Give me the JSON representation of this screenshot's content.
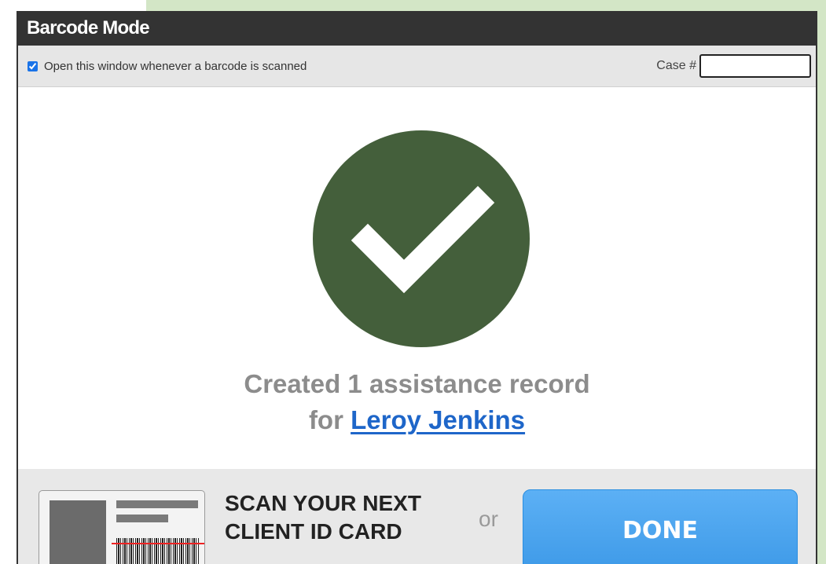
{
  "window": {
    "title": "Barcode Mode"
  },
  "options": {
    "open_on_scan_label": "Open this window whenever a barcode is scanned",
    "open_on_scan_checked": true,
    "case_label": "Case #",
    "case_value": ""
  },
  "result": {
    "icon": "check-circle-icon",
    "line1": "Created 1 assistance record",
    "line2_prefix": "for",
    "client_name": "Leroy Jenkins"
  },
  "footer": {
    "scan_line1": "SCAN YOUR NEXT",
    "scan_line2": "CLIENT ID CARD",
    "or_text": "or",
    "done_label": "DONE"
  },
  "colors": {
    "titlebar": "#333333",
    "check_circle": "#445f3b",
    "link": "#1e66c9",
    "done_button": "#4aa3ee",
    "accent_background": "#d3e6c6"
  }
}
